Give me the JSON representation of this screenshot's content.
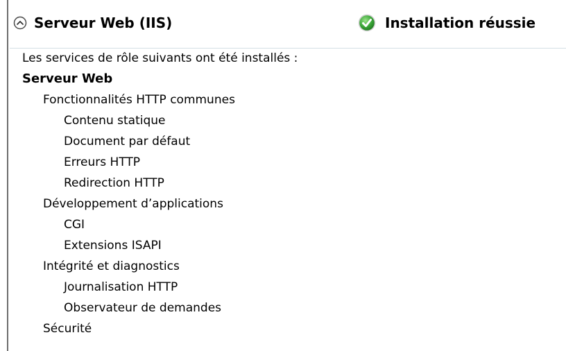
{
  "section": {
    "title": "Serveur Web (IIS)",
    "collapse_icon": "chevron-up-circle-icon",
    "status_icon": "green-checkmark-circle-icon",
    "status_text": "Installation réussie"
  },
  "details": {
    "intro": "Les services de rôle suivants ont été installés :",
    "items": [
      {
        "label": "Serveur Web",
        "level": 0
      },
      {
        "label": "Fonctionnalités HTTP communes",
        "level": 1
      },
      {
        "label": "Contenu statique",
        "level": 2
      },
      {
        "label": "Document par défaut",
        "level": 2
      },
      {
        "label": "Erreurs HTTP",
        "level": 2
      },
      {
        "label": "Redirection HTTP",
        "level": 2
      },
      {
        "label": "Développement d’applications",
        "level": 1
      },
      {
        "label": "CGI",
        "level": 2
      },
      {
        "label": "Extensions ISAPI",
        "level": 2
      },
      {
        "label": "Intégrité et diagnostics",
        "level": 1
      },
      {
        "label": "Journalisation HTTP",
        "level": 2
      },
      {
        "label": "Observateur de demandes",
        "level": 2
      },
      {
        "label": "Sécurité",
        "level": 1
      }
    ]
  },
  "colors": {
    "status_green": "#3da83a",
    "divider": "#d5dfe5"
  }
}
